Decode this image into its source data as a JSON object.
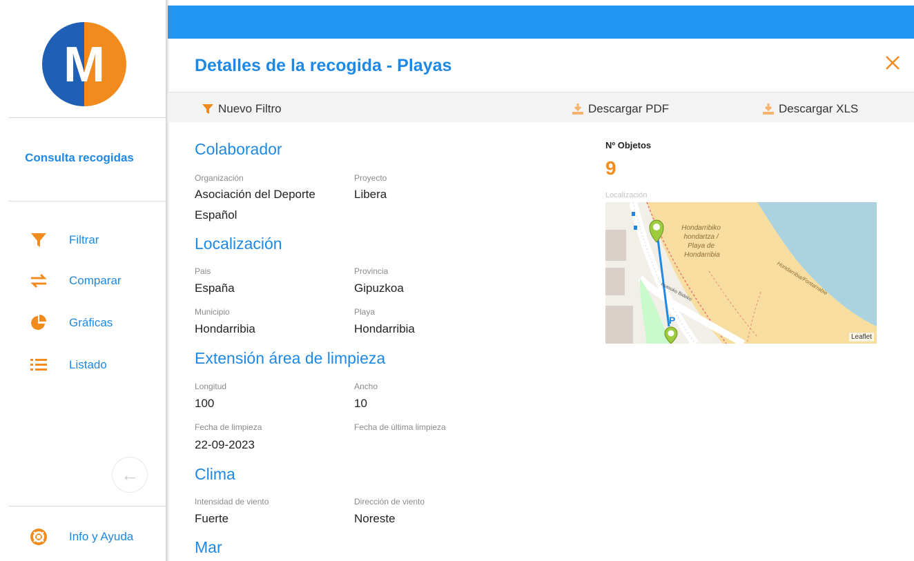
{
  "sidebar": {
    "logo_letter": "M",
    "consulta_label": "Consulta recogidas",
    "items": [
      {
        "label": "Filtrar",
        "icon": "filter-icon"
      },
      {
        "label": "Comparar",
        "icon": "compare-arrows-icon"
      },
      {
        "label": "Gráficas",
        "icon": "pie-chart-icon"
      },
      {
        "label": "Listado",
        "icon": "list-icon"
      }
    ],
    "back_icon": "arrow-left-icon",
    "help": {
      "label": "Info y Ayuda",
      "icon": "lifebuoy-icon"
    }
  },
  "header": {
    "title": "Detalles de la recogida - Playas",
    "close_icon": "close-icon"
  },
  "toolbar": {
    "new_filter_label": "Nuevo Filtro",
    "download_pdf_label": "Descargar PDF",
    "download_xls_label": "Descargar XLS"
  },
  "colaborador": {
    "title": "Colaborador",
    "organizacion_label": "Organización",
    "organizacion_line1": "Asociación del Deporte",
    "organizacion_line2": "Español",
    "proyecto_label": "Proyecto",
    "proyecto_value": "Libera"
  },
  "localizacion": {
    "title": "Localización",
    "pais_label": "Pais",
    "pais_value": "España",
    "provincia_label": "Provincia",
    "provincia_value": "Gipuzkoa",
    "municipio_label": "Municipio",
    "municipio_value": "Hondarribia",
    "playa_label": "Playa",
    "playa_value": "Hondarribia"
  },
  "extension": {
    "title": "Extensión área de limpieza",
    "longitud_label": "Longitud",
    "longitud_value": "100",
    "ancho_label": "Ancho",
    "ancho_value": "10",
    "fecha_label": "Fecha de limpieza",
    "fecha_value": "22-09-2023",
    "fecha_ultima_label": "Fecha de última limpieza"
  },
  "clima": {
    "title": "Clima",
    "intensidad_label": "Intensidad de viento",
    "intensidad_value": "Fuerte",
    "direccion_label": "Dirección de viento",
    "direccion_value": "Noreste"
  },
  "mar": {
    "title": "Mar"
  },
  "objetos": {
    "label": "Nº Objetos",
    "value": "9"
  },
  "map": {
    "label": "Localización",
    "beach_name_lines": [
      "Hondarribiko",
      "hondartza /",
      "Playa de",
      "Hondarribia"
    ],
    "street_label": "Hondarribia/Fontarrabie",
    "road_label": "Itsasoko Bideko",
    "attribution": "Leaflet"
  },
  "colors": {
    "accent_blue": "#1e88e5",
    "topbar_blue": "#2196f3",
    "orange": "#f28b1e"
  }
}
